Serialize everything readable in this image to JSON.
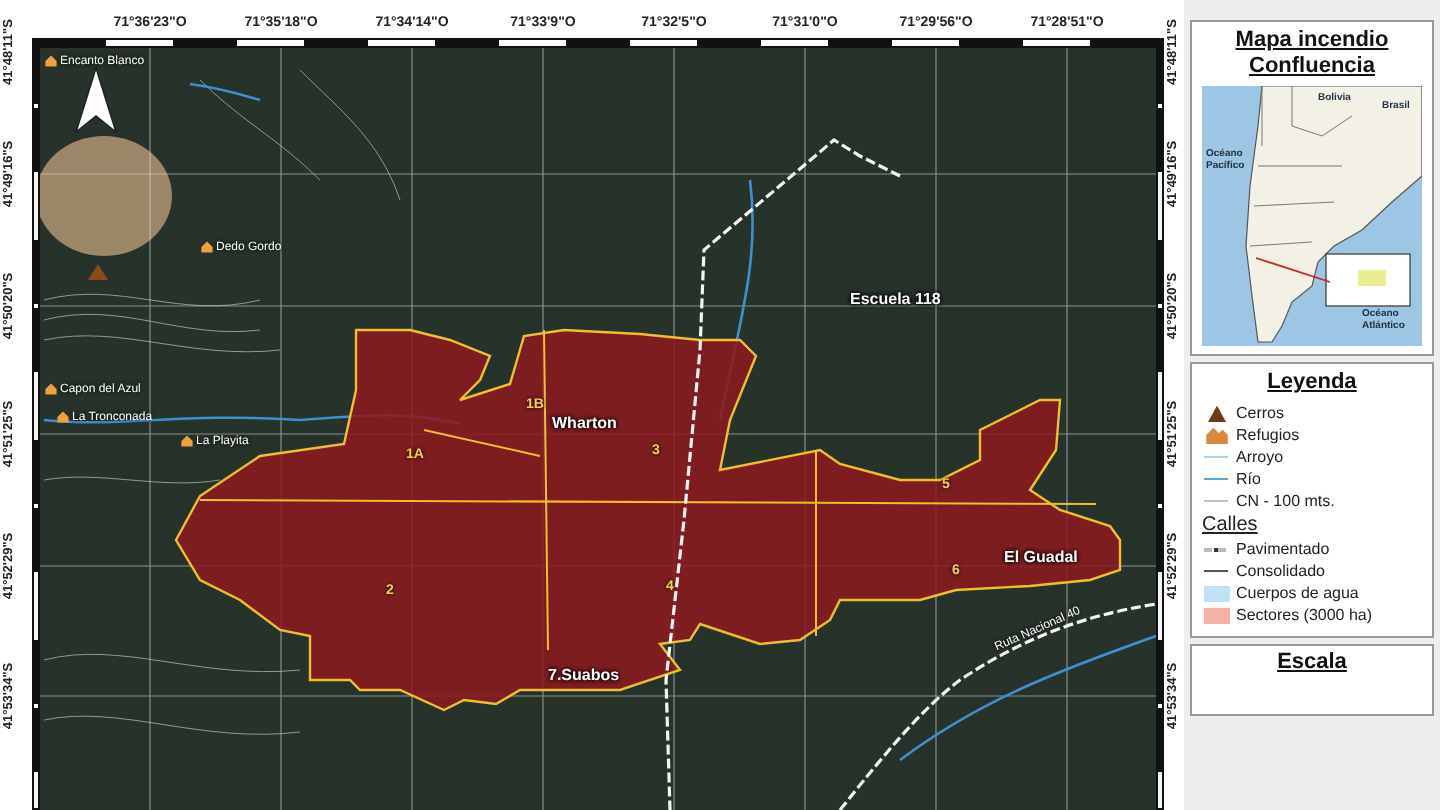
{
  "axes": {
    "longitudes": [
      "71°36'23\"O",
      "71°35'18\"O",
      "71°34'14\"O",
      "71°33'9\"O",
      "71°32'5\"O",
      "71°31'0\"O",
      "71°29'56\"O",
      "71°28'51\"O"
    ],
    "latitudes_left": [
      "41°48'11\"S",
      "41°49'16\"S",
      "41°50'20\"S",
      "41°51'25\"S",
      "41°52'29\"S",
      "41°53'34\"S"
    ],
    "latitudes_right": [
      "41°48'11\"S",
      "41°49'16\"S",
      "41°50'20\"S",
      "41°51'25\"S",
      "41°52'29\"S",
      "41°53'34\"S"
    ]
  },
  "map": {
    "places": [
      {
        "label": "Encanto Blanco",
        "kind": "refuge"
      },
      {
        "label": "Dedo Gordo",
        "kind": "refuge"
      },
      {
        "label": "Capon del Azul",
        "kind": "refuge"
      },
      {
        "label": "La Tronconada",
        "kind": "refuge"
      },
      {
        "label": "La Playita",
        "kind": "refuge"
      },
      {
        "label": "Wharton",
        "kind": "locality"
      },
      {
        "label": "Escuela 118",
        "kind": "locality"
      },
      {
        "label": "El Guadal",
        "kind": "locality"
      },
      {
        "label": "7.Suabos",
        "kind": "locality"
      }
    ],
    "sectors": [
      "1A",
      "1B",
      "2",
      "3",
      "4",
      "5",
      "6"
    ],
    "road_label": "Ruta Nacional 40"
  },
  "inset": {
    "title": "Mapa incendio Confluencia",
    "labels": [
      "Bolivia",
      "Brasil",
      "Océano Pacífico",
      "Océano Atlántico"
    ]
  },
  "legend": {
    "title": "Leyenda",
    "items": [
      {
        "label": "Cerros",
        "kind": "peak"
      },
      {
        "label": "Refugios",
        "kind": "hut"
      },
      {
        "label": "Arroyo",
        "kind": "line",
        "color": "#a9d4ee"
      },
      {
        "label": "Río",
        "kind": "line",
        "color": "#5aa6d6"
      },
      {
        "label": "CN - 100 mts.",
        "kind": "line",
        "color": "#c4c4c4"
      }
    ],
    "streets_title": "Calles",
    "street_items": [
      {
        "label": "Pavimentado",
        "kind": "dashed"
      },
      {
        "label": "Consolidado",
        "kind": "line",
        "color": "#555555"
      },
      {
        "label": "Cuerpos de agua",
        "kind": "swatch",
        "color": "#bfe0f5"
      },
      {
        "label": "Sectores (3000 ha)",
        "kind": "swatch",
        "color": "#f7b0a4"
      }
    ]
  },
  "scale": {
    "title": "Escala"
  }
}
